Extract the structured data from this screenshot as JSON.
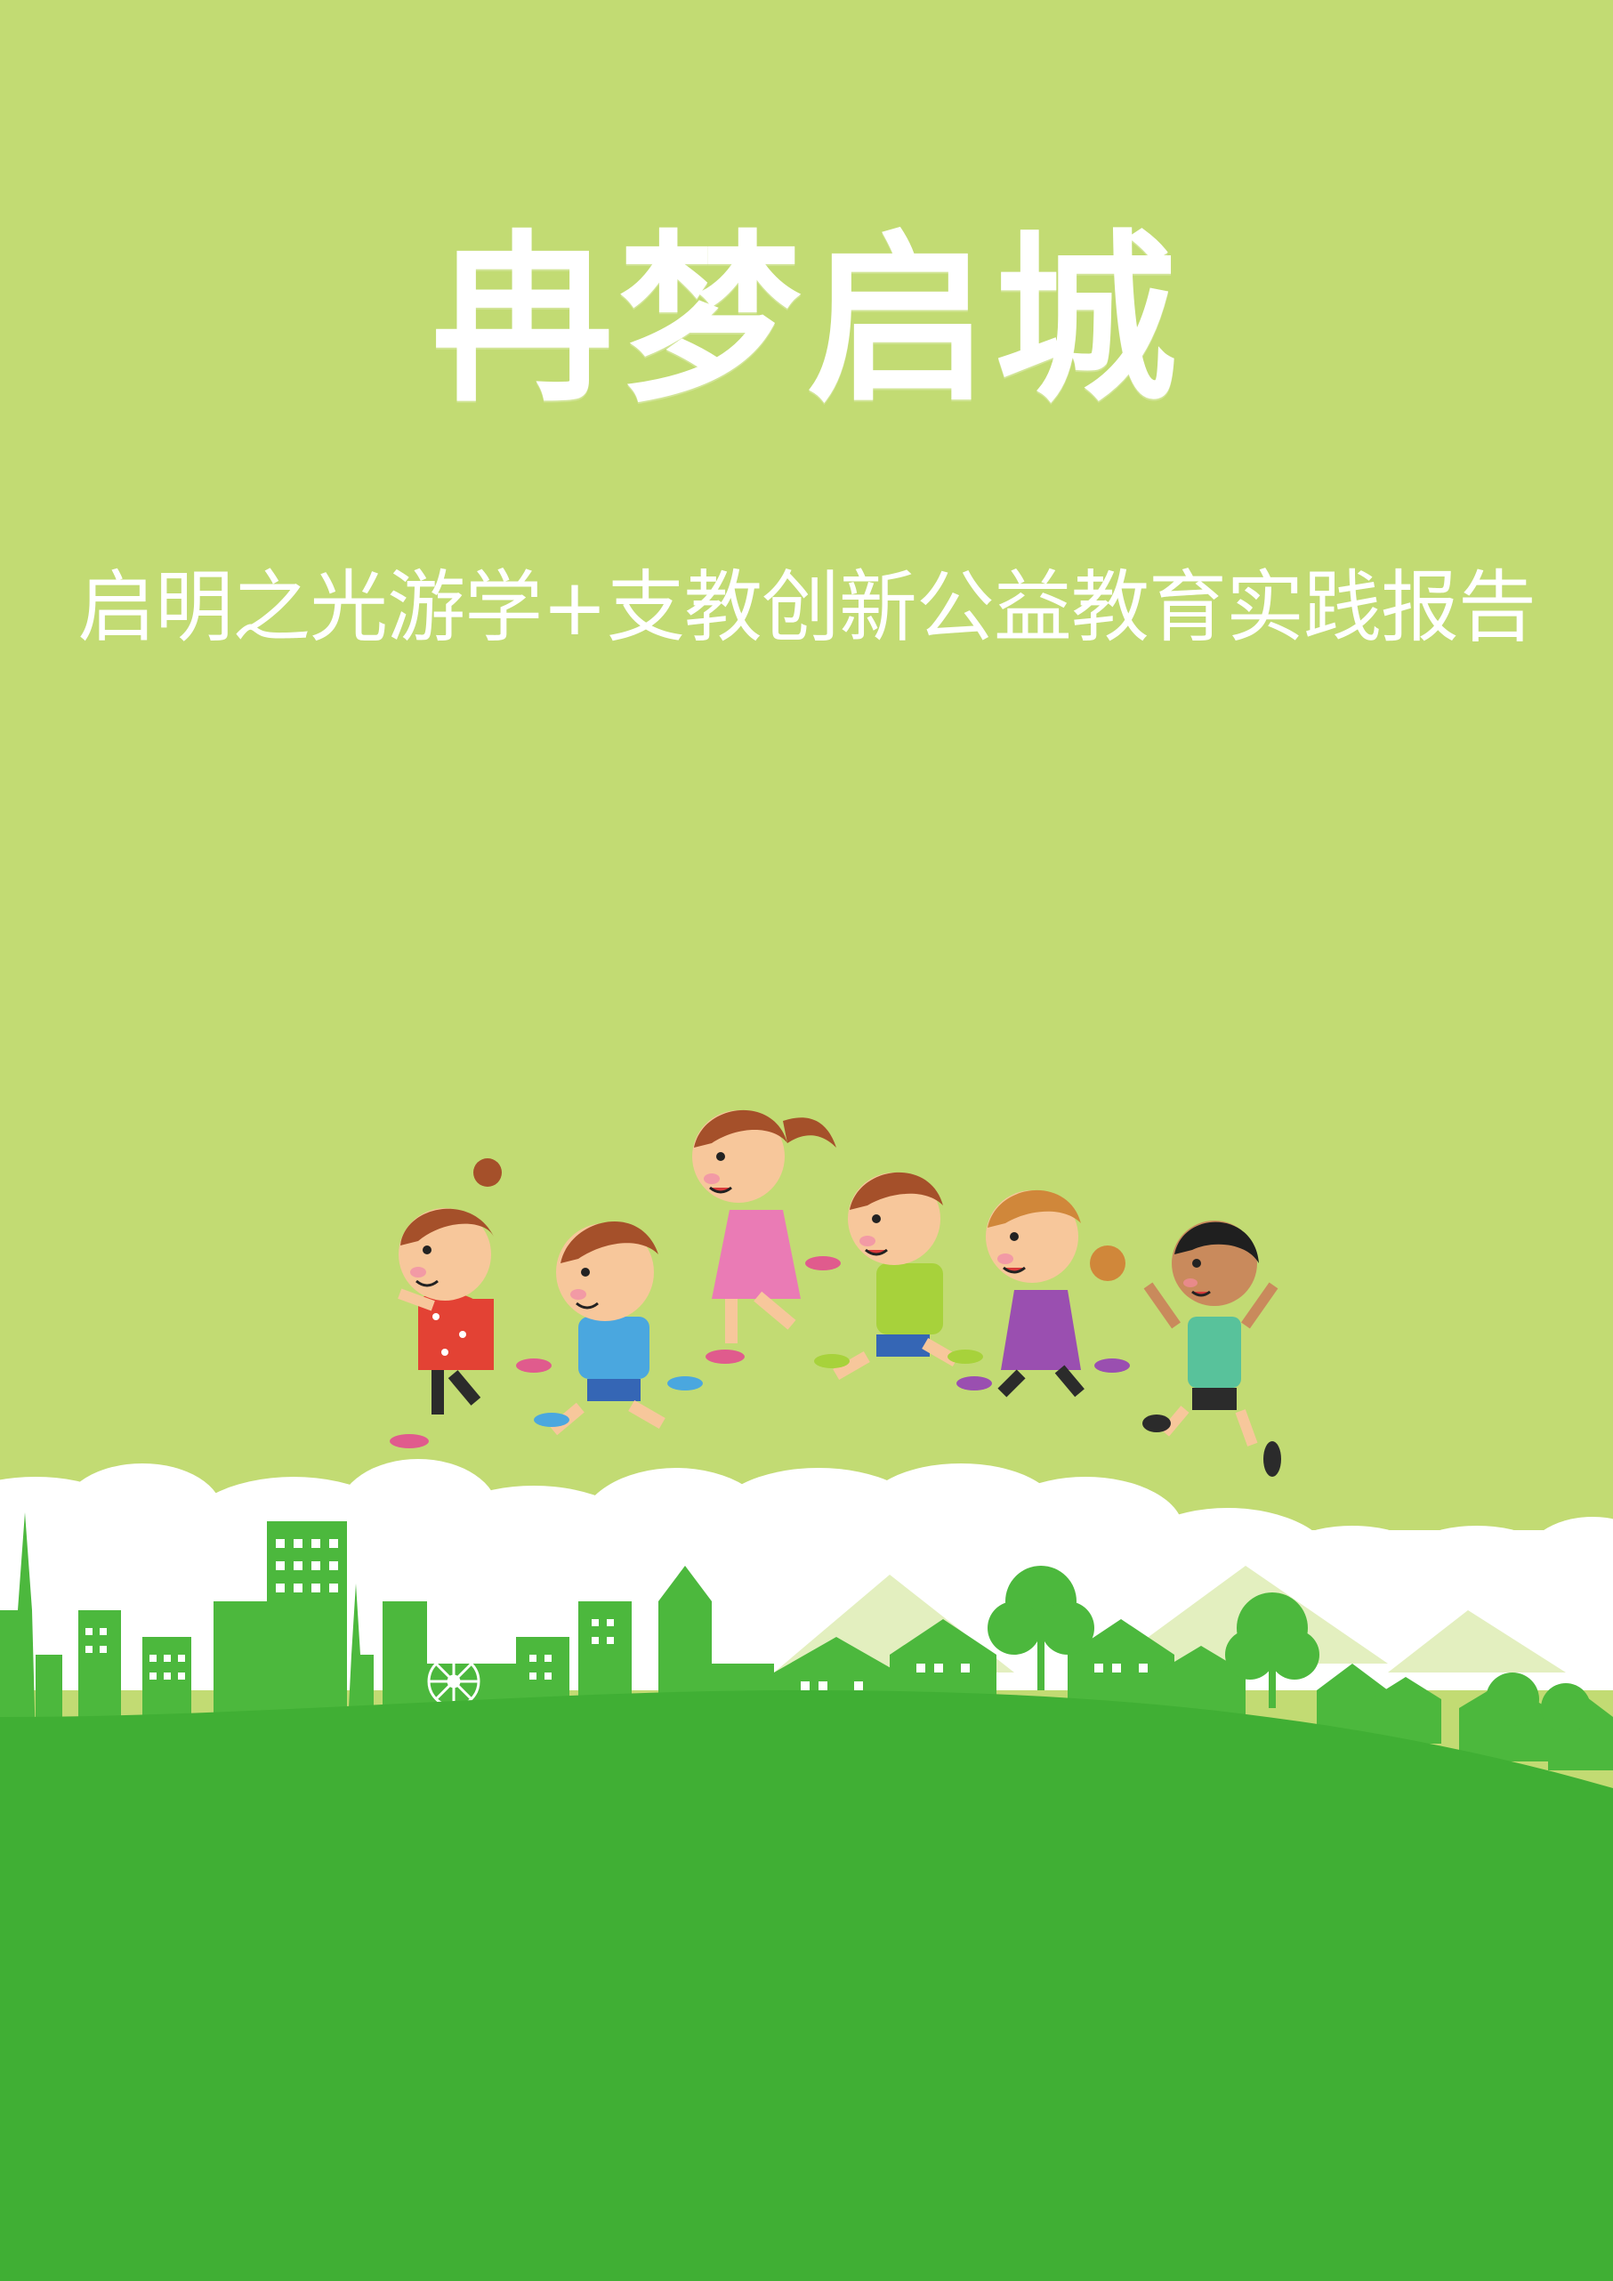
{
  "cover": {
    "title": "冉梦启城",
    "subtitle": "启明之光游学+支教创新公益教育实践报告"
  },
  "colors": {
    "background": "#c2db73",
    "ground": "#40af34",
    "skyline": "#4cb83d",
    "text": "#ffffff"
  },
  "illustration": {
    "children": [
      "red-dress-girl-icon",
      "blue-shirt-boy-icon",
      "pink-dress-girl-icon",
      "green-shirt-boy-icon",
      "purple-dress-girl-icon",
      "teal-shirt-boy-icon"
    ],
    "scene": [
      "cloud-icon",
      "city-skyline-icon",
      "house-icon",
      "tree-icon",
      "ferris-wheel-icon",
      "hill-icon"
    ]
  }
}
